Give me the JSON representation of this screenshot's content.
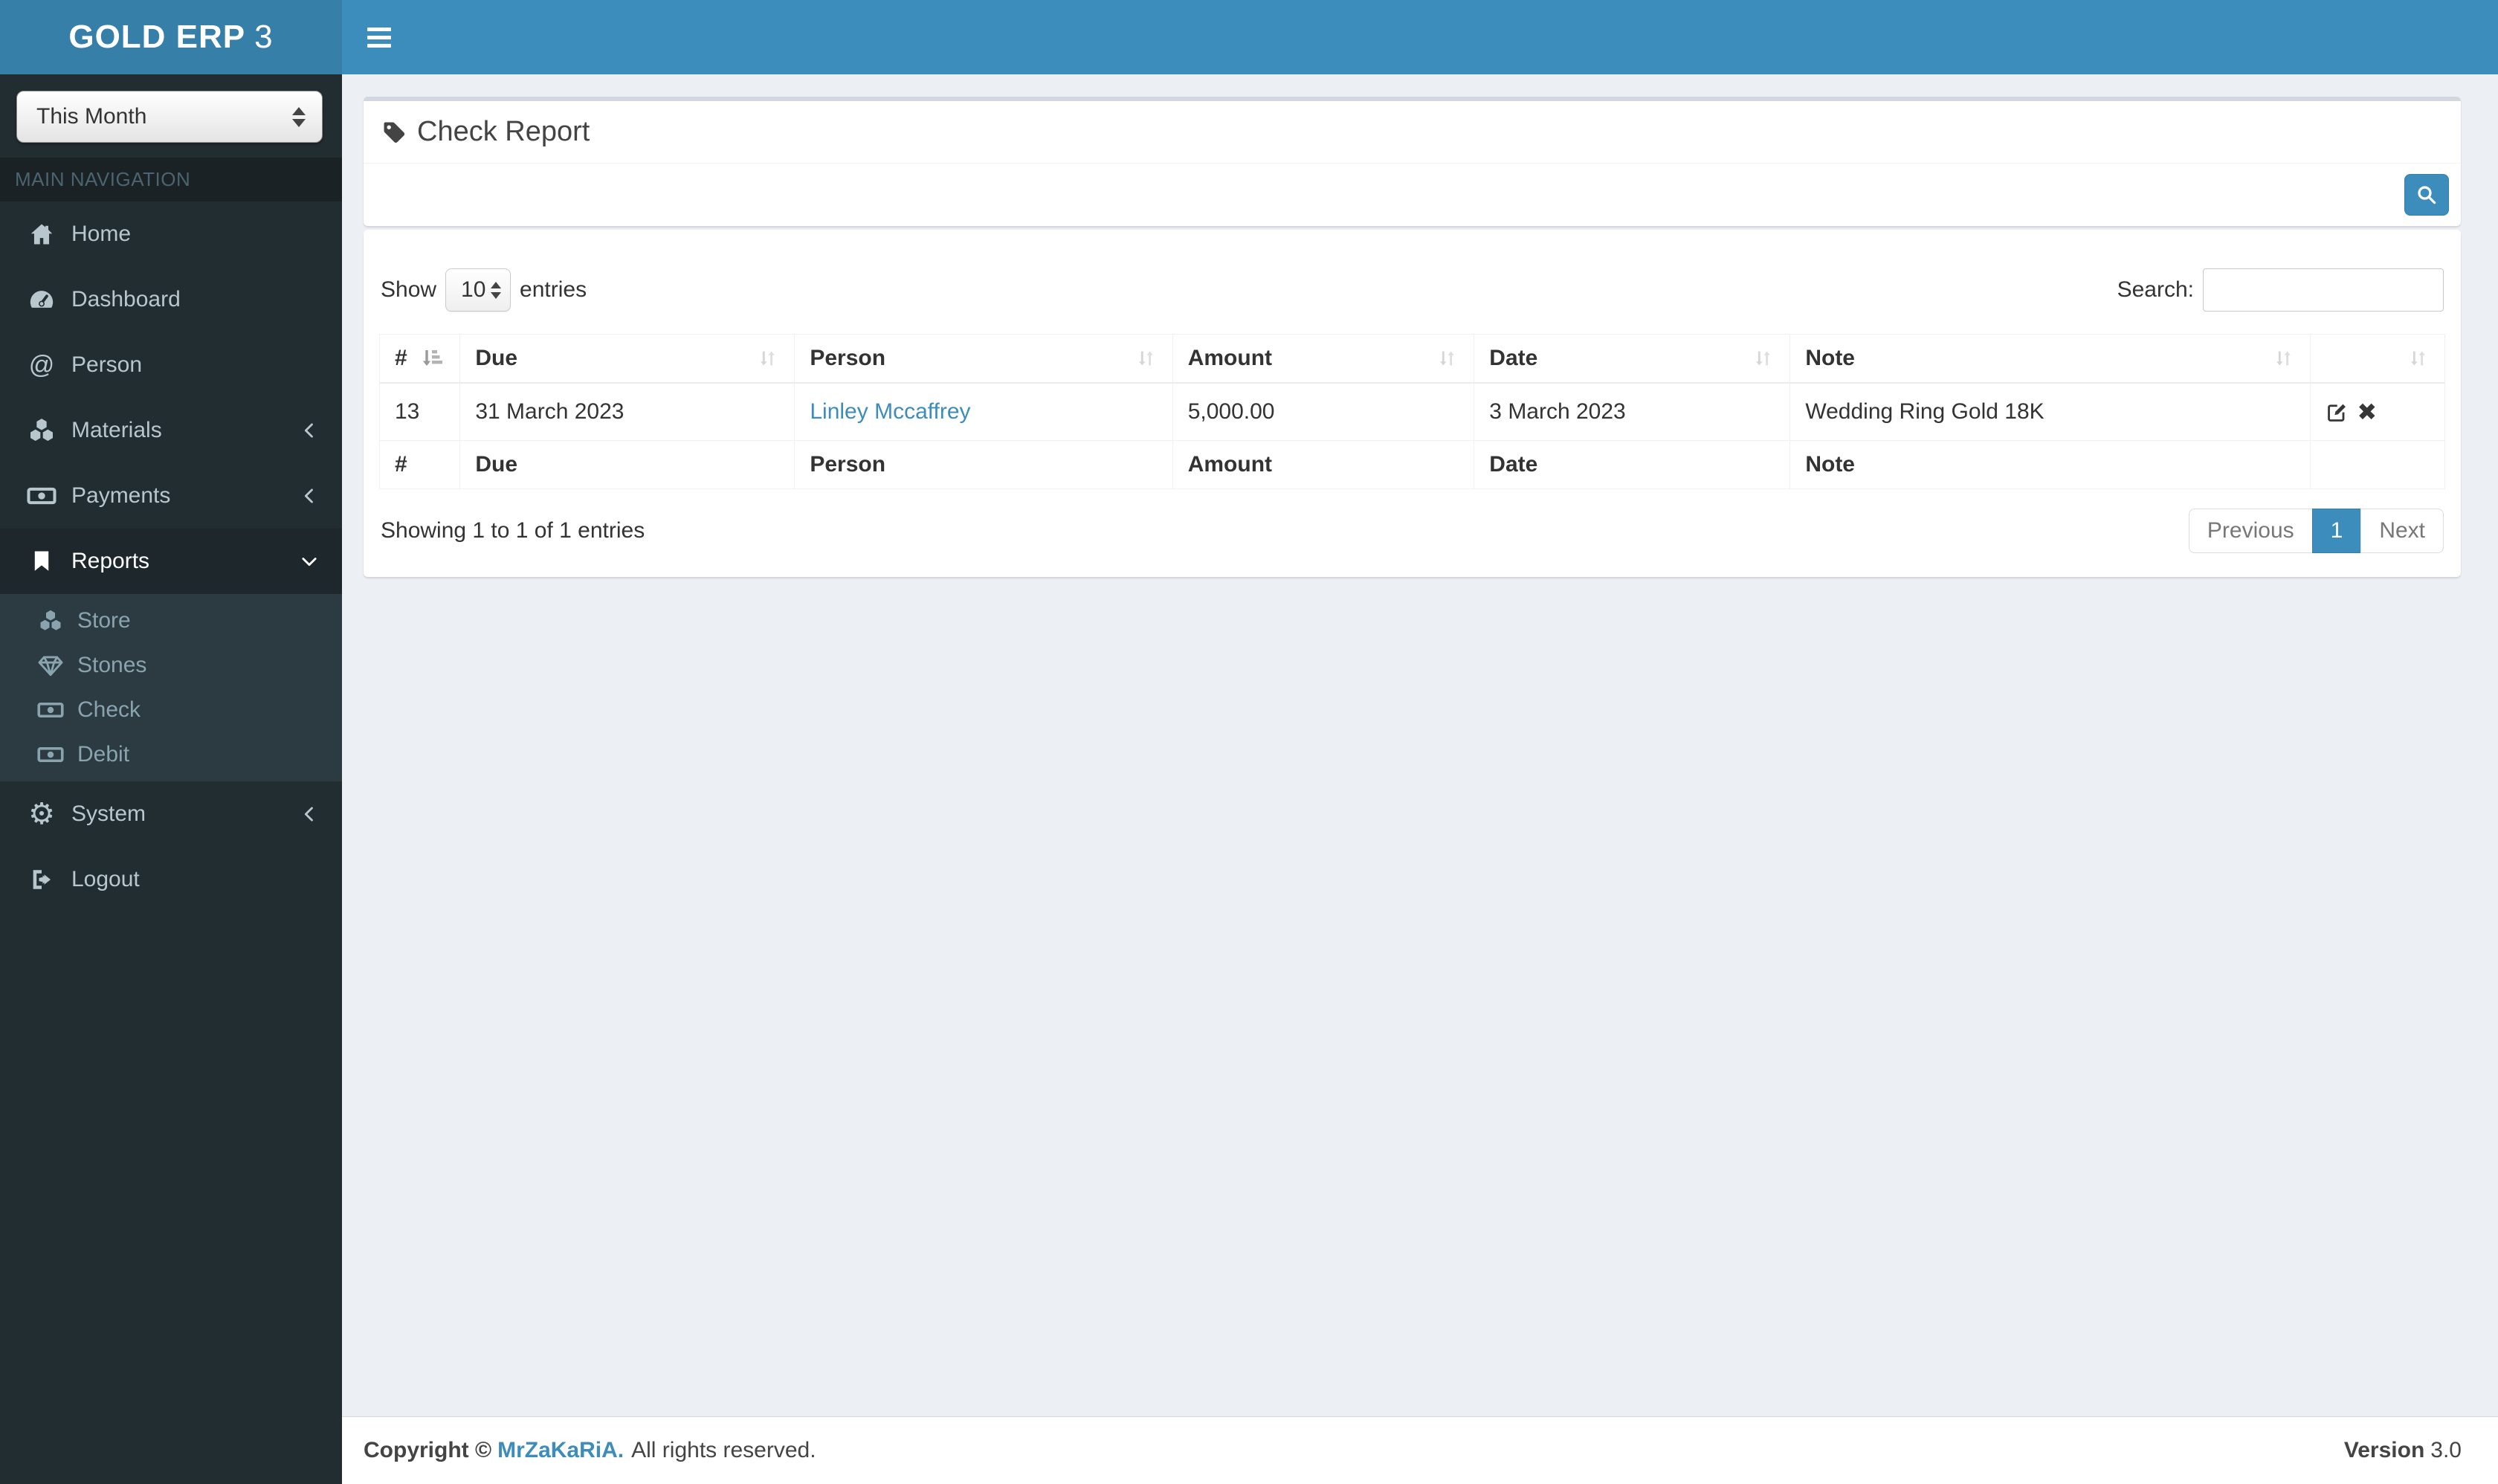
{
  "brand": {
    "bold": "GOLD ERP",
    "light": "3"
  },
  "sidebar": {
    "period_value": "This Month",
    "section_label": "MAIN NAVIGATION",
    "items": {
      "home": "Home",
      "dashboard": "Dashboard",
      "person": "Person",
      "materials": "Materials",
      "payments": "Payments",
      "reports": "Reports",
      "store": "Store",
      "stones": "Stones",
      "check": "Check",
      "debit": "Debit",
      "system": "System",
      "logout": "Logout"
    }
  },
  "page": {
    "title": "Check Report"
  },
  "table": {
    "show_label": "Show",
    "page_size_value": "10",
    "entries_label": "entries",
    "search_label": "Search:",
    "search_value": "",
    "headers": {
      "id": "#",
      "due": "Due",
      "person": "Person",
      "amount": "Amount",
      "date": "Date",
      "note": "Note"
    },
    "row": {
      "id": "13",
      "due": "31 March 2023",
      "person": "Linley Mccaffrey",
      "amount": "5,000.00",
      "date": "3 March 2023",
      "note": "Wedding Ring Gold 18K"
    },
    "info": "Showing 1 to 1 of 1 entries",
    "pagination": {
      "previous": "Previous",
      "page": "1",
      "next": "Next"
    }
  },
  "footer": {
    "copyright_prefix": "Copyright ©",
    "author_link": "MrZaKaRiA.",
    "rights": "All rights reserved.",
    "version_label": "Version",
    "version_value": "3.0"
  },
  "colors": {
    "navbar": "#3c8dbc",
    "logo_bg": "#367fa9",
    "sidebar_bg": "#222d32",
    "accent": "#3c8dbc"
  }
}
